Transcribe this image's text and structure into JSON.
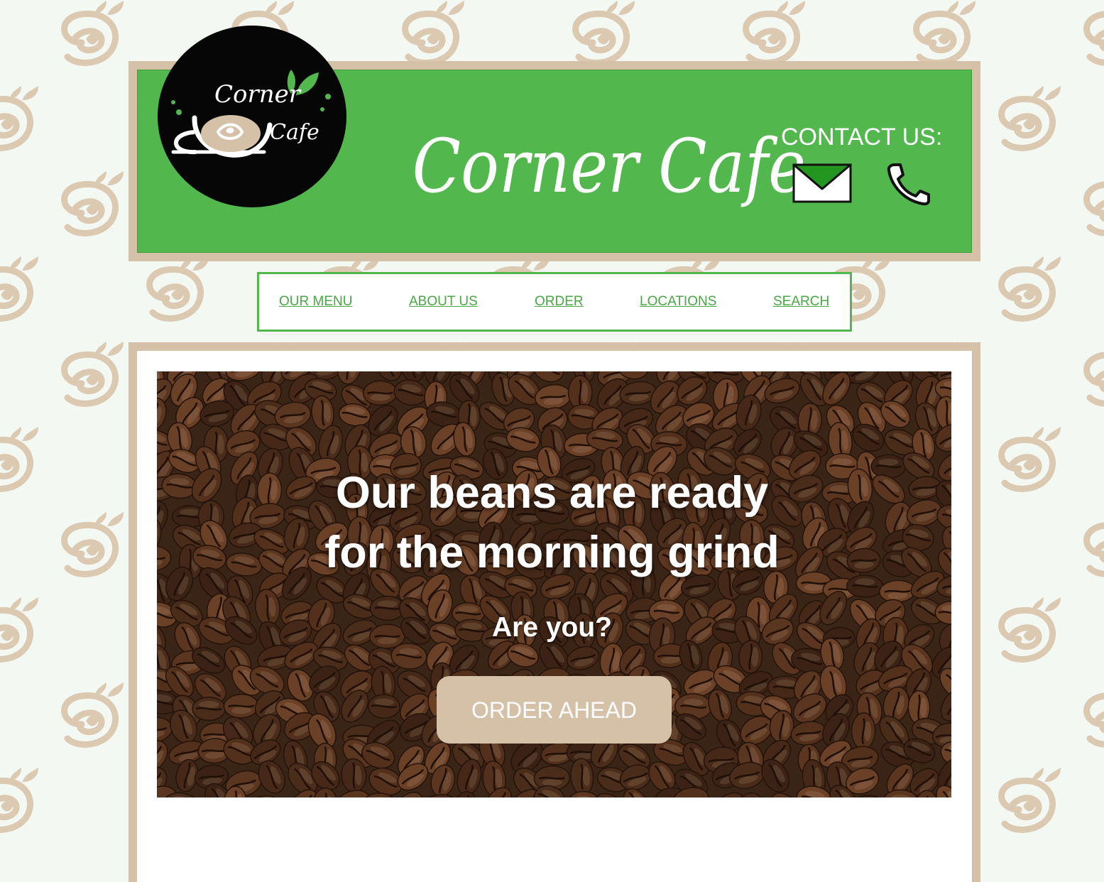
{
  "header": {
    "logo_text_line1": "Corner",
    "logo_text_line2": "Cafe",
    "title": "Corner Cafe",
    "contact_label": "CONTACT US:"
  },
  "icons": {
    "mail": "mail-icon",
    "phone": "phone-icon",
    "logo": "coffee-cup-logo"
  },
  "nav": {
    "items": [
      {
        "label": "OUR MENU"
      },
      {
        "label": "ABOUT US"
      },
      {
        "label": "ORDER"
      },
      {
        "label": "LOCATIONS"
      },
      {
        "label": "SEARCH"
      }
    ]
  },
  "hero": {
    "headline_line1": "Our beans are ready",
    "headline_line2": "for the morning grind",
    "subheadline": "Are you?",
    "cta_label": "ORDER AHEAD"
  },
  "colors": {
    "brand_green": "#52b84d",
    "beige": "#d5c1a8",
    "background": "#f4f8f3",
    "logo_black": "#060606"
  }
}
